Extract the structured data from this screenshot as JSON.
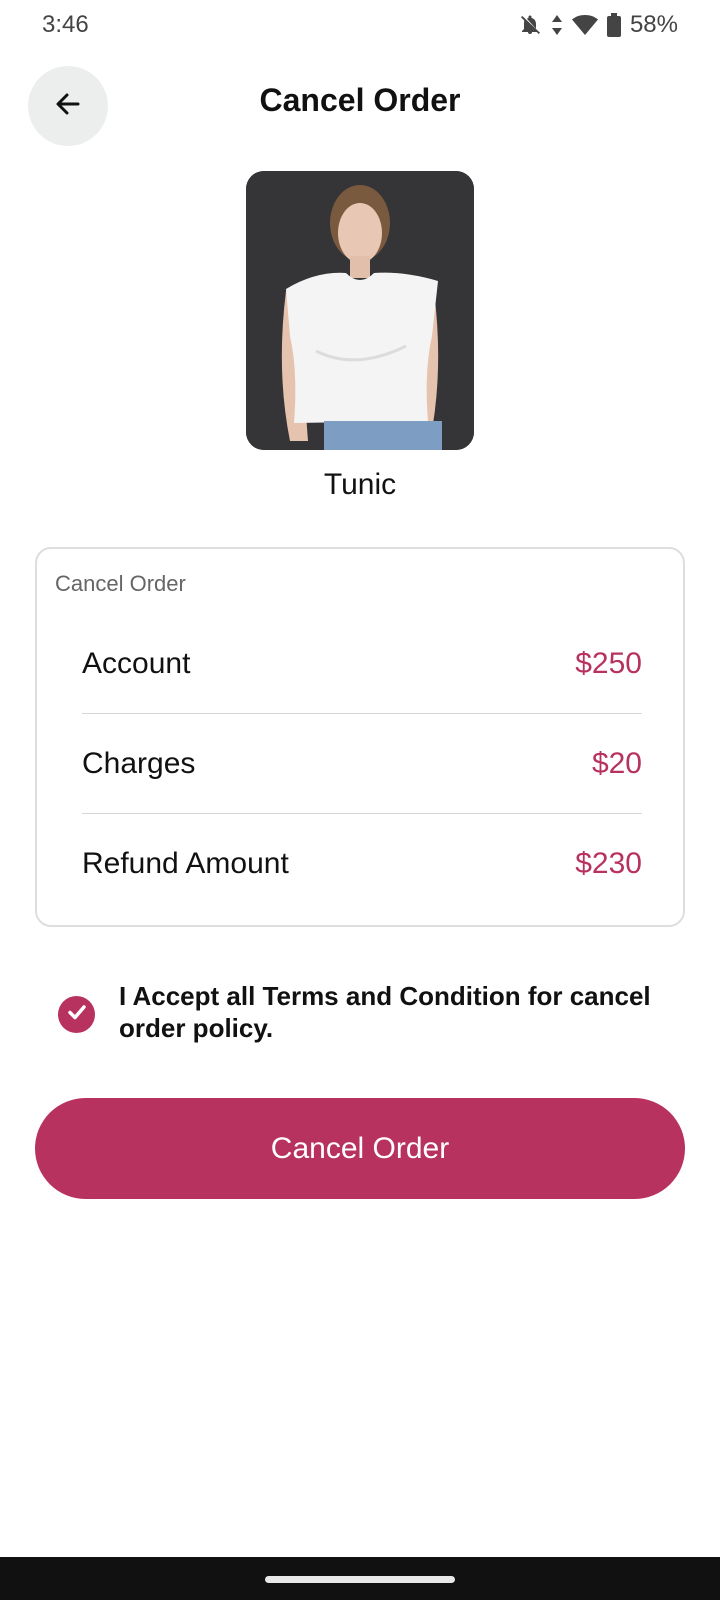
{
  "status_bar": {
    "time": "3:46",
    "battery": "58%",
    "icons": [
      "bell-off-icon",
      "data-arrows-icon",
      "wifi-icon",
      "battery-icon"
    ]
  },
  "header": {
    "title": "Cancel Order",
    "back_icon": "arrow-left-icon"
  },
  "product": {
    "name": "Tunic"
  },
  "summary": {
    "label": "Cancel Order",
    "rows": [
      {
        "label": "Account",
        "value": "$250"
      },
      {
        "label": "Charges",
        "value": "$20"
      },
      {
        "label": "Refund Amount",
        "value": "$230"
      }
    ]
  },
  "terms": {
    "checked": true,
    "text": "I Accept all Terms and Condition for cancel order policy."
  },
  "actions": {
    "cancel_label": "Cancel Order"
  },
  "colors": {
    "accent": "#b83260",
    "back_button_bg": "#eceeed"
  }
}
